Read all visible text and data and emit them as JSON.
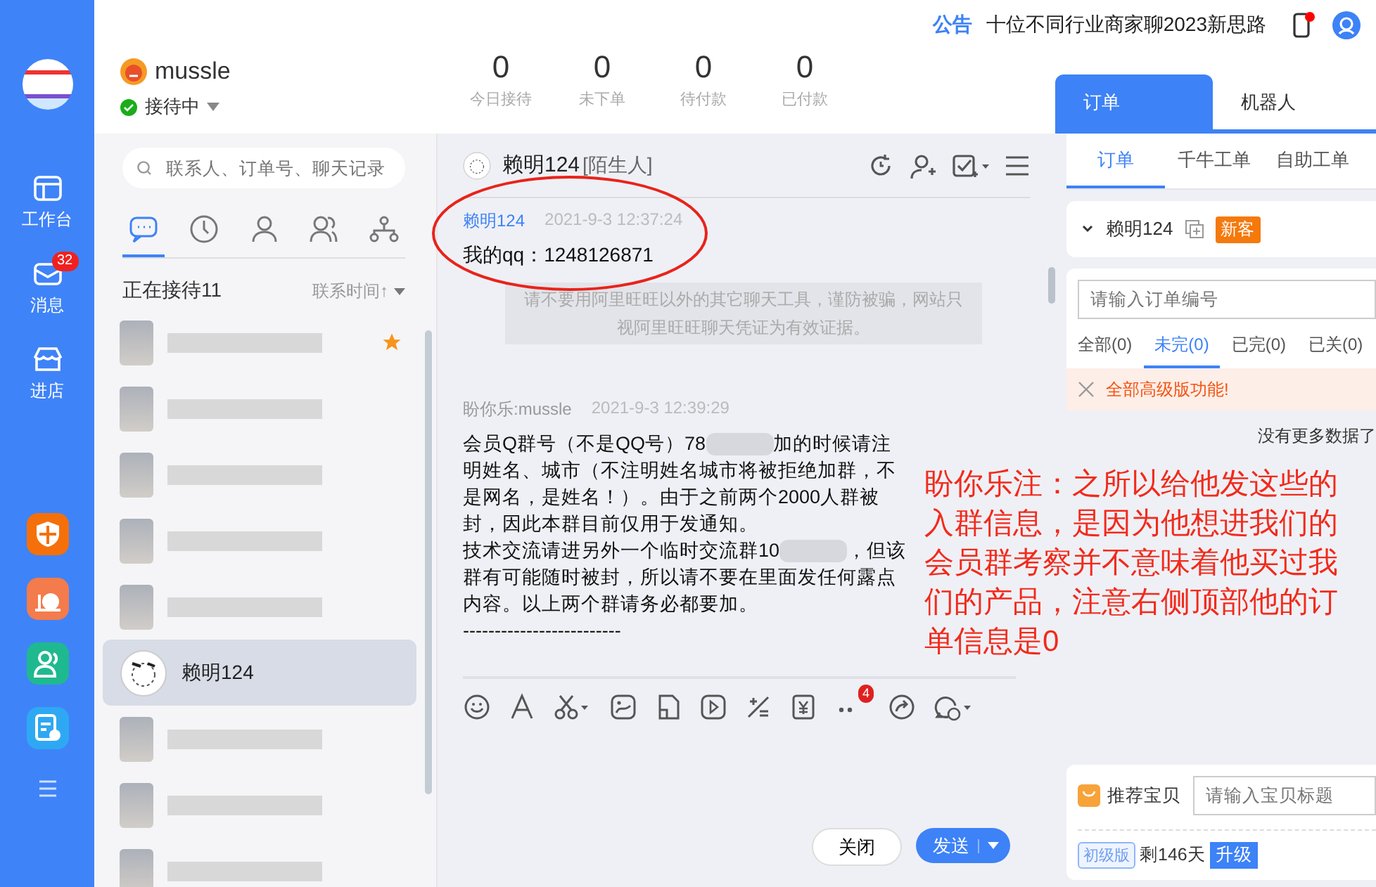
{
  "topbar": {
    "notice_label": "公告",
    "notice_text": "十位不同行业商家聊2023新思路"
  },
  "rail": {
    "items": [
      {
        "label": "工作台"
      },
      {
        "label": "消息",
        "badge": "32"
      },
      {
        "label": "进店"
      }
    ],
    "apps": [
      {
        "color": "#f5700a"
      },
      {
        "color": "#f47b4b"
      },
      {
        "color": "#1fb98f"
      },
      {
        "color": "#2fa8f3"
      }
    ]
  },
  "profile": {
    "name": "mussle",
    "status": "接待中",
    "online": true
  },
  "stats": [
    {
      "value": "0",
      "label": "今日接待"
    },
    {
      "value": "0",
      "label": "未下单"
    },
    {
      "value": "0",
      "label": "待付款"
    },
    {
      "value": "0",
      "label": "已付款"
    }
  ],
  "contacts": {
    "search_placeholder": "联系人、订单号、聊天记录",
    "tabs": [
      {
        "selected": true
      },
      {
        "selected": false
      },
      {
        "selected": false
      },
      {
        "selected": false
      },
      {
        "selected": false
      }
    ],
    "title": "正在接待11",
    "sort": "联系时间↑",
    "items": [
      {
        "kind": "blurred",
        "starred": true,
        "selected": false
      },
      {
        "kind": "blurred",
        "starred": false,
        "selected": false
      },
      {
        "kind": "blurred",
        "starred": false,
        "selected": false
      },
      {
        "kind": "blurred",
        "starred": false,
        "selected": false
      },
      {
        "kind": "blurred",
        "starred": false,
        "selected": false
      },
      {
        "kind": "named",
        "name": "赖明124",
        "starred": false,
        "selected": true
      },
      {
        "kind": "blurred",
        "starred": false,
        "selected": false
      },
      {
        "kind": "blurred",
        "starred": false,
        "selected": false
      },
      {
        "kind": "blurred",
        "starred": false,
        "selected": false
      }
    ]
  },
  "chat": {
    "title": "赖明124",
    "tag": "[陌生人]",
    "messages": [
      {
        "kind": "incoming",
        "sender": "赖明124",
        "time": "2021-9-3 12:37:24",
        "parts": [
          {
            "kind": "text",
            "text": "我的qq：1248126871"
          }
        ]
      },
      {
        "kind": "system",
        "text": "请不要用阿里旺旺以外的其它聊天工具，谨防被骗，网站只视阿里旺旺聊天凭证为有效证据。"
      },
      {
        "kind": "outgoing",
        "sender": "盼你乐:mussle",
        "time": "2021-9-3 12:39:29",
        "parts": [
          {
            "kind": "text",
            "text": "会员Q群号（不是QQ号）78"
          },
          {
            "kind": "blur"
          },
          {
            "kind": "text",
            "text": "加的时候请注明姓名、城市（不注明姓名城市将被拒绝加群，不是网名，是姓名！）。由于之前两个2000人群被封，因此本群目前仅用于发通知。"
          },
          {
            "kind": "break"
          },
          {
            "kind": "text",
            "text": "技术交流请进另外一个临时交流群10"
          },
          {
            "kind": "blur"
          },
          {
            "kind": "text",
            "text": "，但该群有可能随时被封，所以请不要在里面发任何露点内容。以上两个群请务必都要加。"
          },
          {
            "kind": "break"
          },
          {
            "kind": "text",
            "text": "-------------------------"
          }
        ]
      }
    ],
    "more_badge": "4",
    "close": "关闭",
    "send": "发送"
  },
  "annotation": {
    "text": "盼你乐注：之所以给他发这些的入群信息，是因为他想进我们的会员群考察并不意味着他买过我们的产品，注意右侧顶部他的订单信息是0"
  },
  "side": {
    "tabs": [
      {
        "label": "订单",
        "selected": true
      },
      {
        "label": "机器人",
        "selected": false
      }
    ],
    "subtabs": [
      {
        "label": "订单",
        "selected": true
      },
      {
        "label": "千牛工单",
        "selected": false
      },
      {
        "label": "自助工单",
        "selected": false
      }
    ],
    "customer": {
      "name": "赖明124",
      "badge": "新客"
    },
    "order_placeholder": "请输入订单编号",
    "filters": [
      {
        "label": "全部(0)",
        "selected": false
      },
      {
        "label": "未完(0)",
        "selected": true
      },
      {
        "label": "已完(0)",
        "selected": false
      },
      {
        "label": "已关(0)",
        "selected": false
      }
    ],
    "alert": "全部高级版功能!",
    "empty": "没有更多数据了",
    "recommend": {
      "label": "推荐宝贝",
      "placeholder": "请输入宝贝标题"
    },
    "plan": {
      "badge": "初级版",
      "remaining": "剩146天",
      "upgrade": "升级"
    }
  }
}
